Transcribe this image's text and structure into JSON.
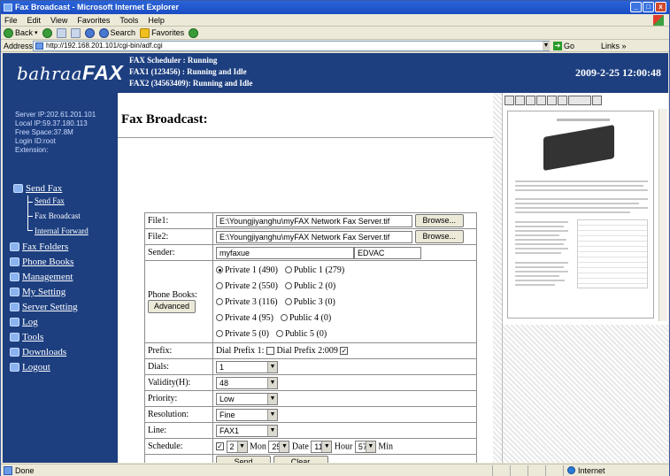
{
  "window": {
    "title": "Fax Broadcast - Microsoft Internet Explorer",
    "controls": [
      "_",
      "□",
      "x"
    ]
  },
  "menu": [
    "File",
    "Edit",
    "View",
    "Favorites",
    "Tools",
    "Help"
  ],
  "toolbar": {
    "back": "Back",
    "search": "Search",
    "favorites": "Favorites"
  },
  "address": {
    "label": "Address",
    "url": "http://192.168.201.101/cgi-bin/adf.cgi",
    "go": "Go",
    "links": "Links »"
  },
  "banner": {
    "brand_pre": "bahraa",
    "brand_post": "FAX",
    "status_lines": [
      "FAX Scheduler  : Running",
      "FAX1 (123456)   : Running and Idle",
      "FAX2 (34563409): Running and Idle"
    ],
    "datetime": "2009-2-25 12:00:48"
  },
  "server_info": [
    "Server IP:202.61.201.101",
    "Local IP:59.37.180.113",
    "Free Space:37.8M",
    "Login ID:root",
    "Extension:"
  ],
  "nav": {
    "send_fax": "Send Fax",
    "send_fax_sub": "Send Fax",
    "fax_broadcast": "Fax Broadcast",
    "internal_forward": "Internal Forward",
    "fax_folders": "Fax Folders",
    "phone_books": "Phone Books",
    "management": "Management",
    "my_setting": "My Setting",
    "server_setting": "Server Setting",
    "log": "Log",
    "tools": "Tools",
    "downloads": "Downloads",
    "logout": "Logout"
  },
  "page": {
    "title": "Fax Broadcast:"
  },
  "form": {
    "file1_label": "File1:",
    "file1_value": "E:\\Youngjiyanghu\\myFAX Network Fax Server.tif",
    "file2_label": "File2:",
    "file2_value": "E:\\Youngjiyanghu\\myFAX Network Fax Server.tif",
    "browse": "Browse...",
    "sender_label": "Sender:",
    "sender_value": "myfaxue",
    "sender_value2": "EDVAC",
    "phonebooks_label": "Phone Books:",
    "advanced": "Advanced",
    "phonebooks": [
      [
        "Private 1 (490)",
        "Public 1 (279)"
      ],
      [
        "Private 2 (550)",
        "Public 2 (0)"
      ],
      [
        "Private 3 (116)",
        "Public 3 (0)"
      ],
      [
        "Private 4 (95)",
        "Public 4 (0)"
      ],
      [
        "Private 5 (0)",
        "Public 5 (0)"
      ]
    ],
    "prefix_label": "Prefix:",
    "dial_prefix1": "Dial Prefix 1:",
    "dial_prefix2": "Dial Prefix 2:009",
    "dials_label": "Dials:",
    "dials_value": "1",
    "validity_label": "Validity(H):",
    "validity_value": "48",
    "priority_label": "Priority:",
    "priority_value": "Low",
    "resolution_label": "Resolution:",
    "resolution_value": "Fine",
    "line_label": "Line:",
    "line_value": "FAX1",
    "schedule_label": "Schedule:",
    "sched_month": "2",
    "sched_mon_label": "Mon",
    "sched_date": "25",
    "sched_date_label": "Date",
    "sched_hour": "11",
    "sched_hour_label": "Hour",
    "sched_min": "57",
    "sched_min_label": "Min",
    "send": "Send",
    "clear": "Clear"
  },
  "statusbar": {
    "left": "Done",
    "right": "Internet"
  }
}
